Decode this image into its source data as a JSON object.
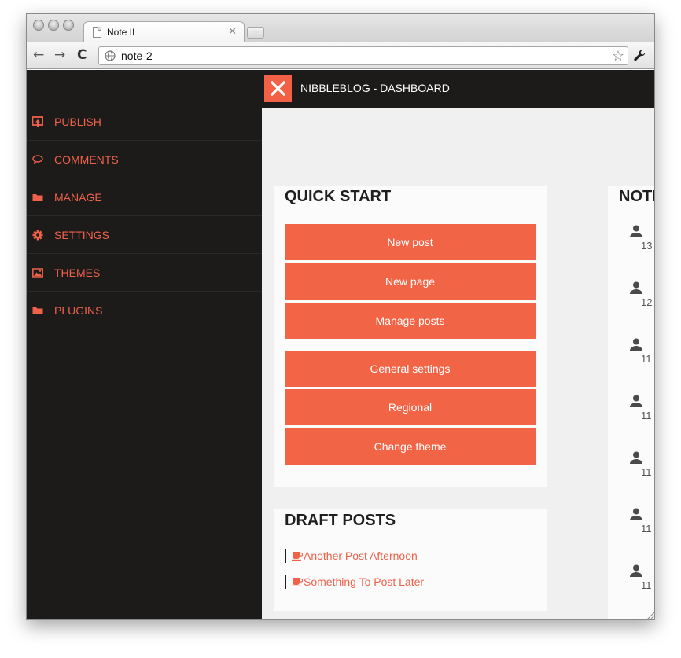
{
  "browser": {
    "tab_title": "Note II",
    "url": "note-2",
    "tab_close": "✕",
    "new_tab": "+",
    "back": "←",
    "forward": "→",
    "reload": "C",
    "star": "☆"
  },
  "header": {
    "title": "NIBBLEBLOG - DASHBOARD"
  },
  "sidebar": {
    "items": [
      {
        "label": "PUBLISH",
        "icon": "publish-icon"
      },
      {
        "label": "COMMENTS",
        "icon": "comment-bubble-icon"
      },
      {
        "label": "MANAGE",
        "icon": "folder-icon"
      },
      {
        "label": "SETTINGS",
        "icon": "gear-icon"
      },
      {
        "label": "THEMES",
        "icon": "image-icon"
      },
      {
        "label": "PLUGINS",
        "icon": "folder-icon"
      }
    ]
  },
  "quick_start": {
    "title": "QUICK START",
    "buttons": [
      "New post",
      "New page",
      "Manage posts",
      "General settings",
      "Regional",
      "Change theme"
    ]
  },
  "drafts": {
    "title": "DRAFT POSTS",
    "items": [
      "Another Post Afternoon",
      "Something To Post Later"
    ]
  },
  "notifications": {
    "title": "NOTI",
    "items": [
      "13",
      "12",
      "11",
      "11",
      "11",
      "11",
      "11"
    ]
  },
  "colors": {
    "accent": "#f26446",
    "sidebar_bg": "#1c1b1a",
    "content_bg": "#f0f0f0"
  }
}
